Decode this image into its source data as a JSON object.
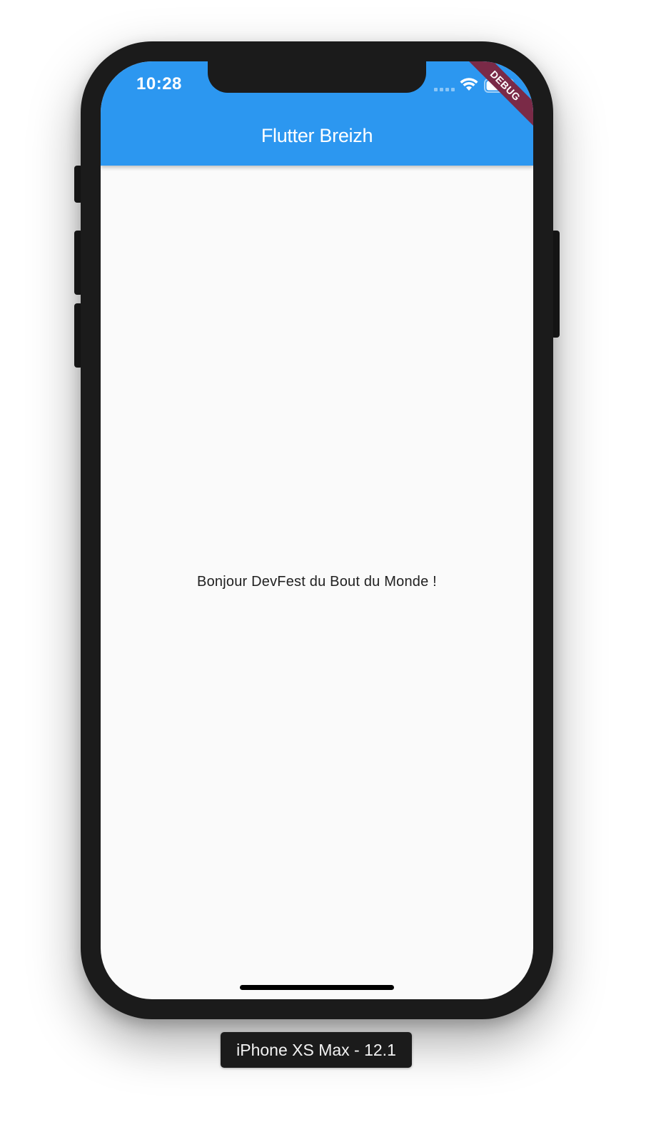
{
  "status_bar": {
    "time": "10:28"
  },
  "app_bar": {
    "title": "Flutter Breizh",
    "color": "#2c97f0"
  },
  "debug_banner": {
    "label": "DEBUG",
    "color": "#7a2a47"
  },
  "body": {
    "message": "Bonjour DevFest du Bout du Monde !"
  },
  "simulator": {
    "device_label": "iPhone XS Max - 12.1"
  },
  "icons": {
    "signal": "cellular-signal-icon",
    "wifi": "wifi-icon",
    "battery": "battery-icon"
  }
}
